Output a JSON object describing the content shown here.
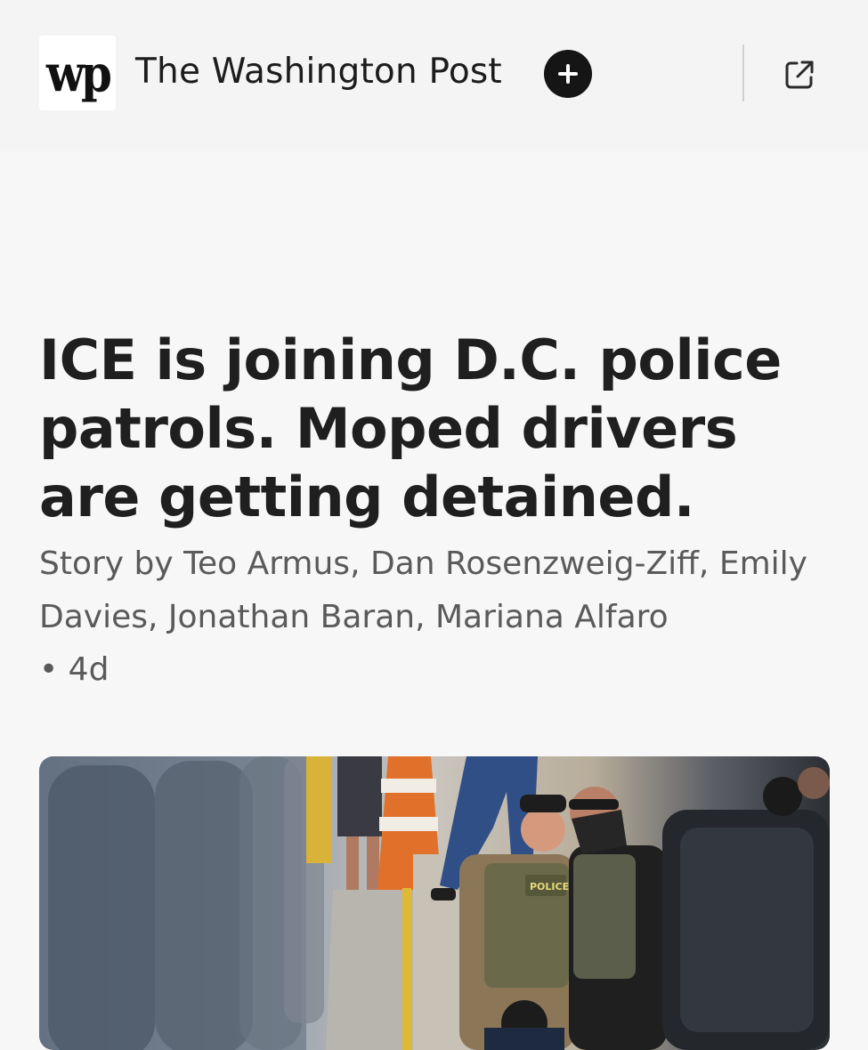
{
  "header": {
    "logo": {
      "text": "wp",
      "icon": "washington-post-logo"
    },
    "publication_name": "The Washington Post",
    "follow_icon": "plus-icon",
    "open_external_icon": "external-link-icon"
  },
  "article": {
    "headline": "ICE is joining D.C. police patrols. Moped drivers are getting detained.",
    "byline": "Story by Teo Armus, Dan Rosenzweig-Ziff, Emily Davies, Jonathan Baran, Mariana Alfaro",
    "meta": "• 4d",
    "hero_image": {
      "vest_label": "POLICE"
    }
  }
}
